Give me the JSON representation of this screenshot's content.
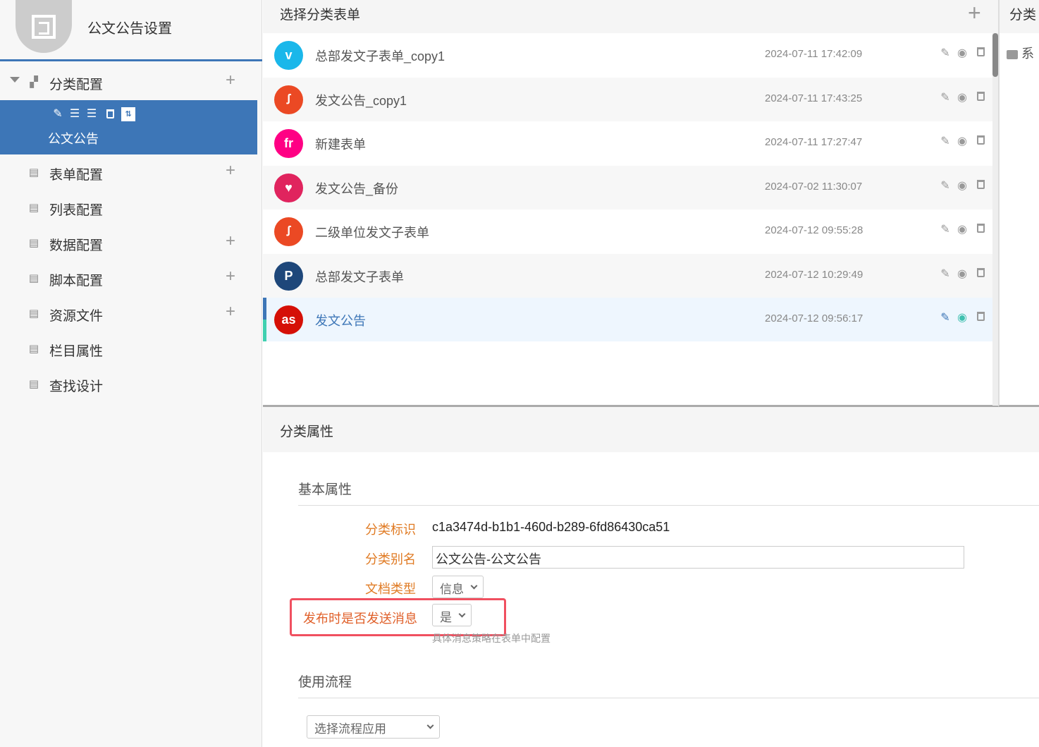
{
  "app": {
    "title": "公文公告设置"
  },
  "sidebar": {
    "group": "分类配置",
    "selected": "公文公告",
    "items": [
      {
        "label": "表单配置",
        "icon": "form-icon",
        "plus": true
      },
      {
        "label": "列表配置",
        "icon": "list-icon",
        "plus": false
      },
      {
        "label": "数据配置",
        "icon": "chart-icon",
        "plus": true
      },
      {
        "label": "脚本配置",
        "icon": "terminal-icon",
        "plus": true
      },
      {
        "label": "资源文件",
        "icon": "terminal-icon",
        "plus": true
      },
      {
        "label": "栏目属性",
        "icon": "sliders-icon",
        "plus": false
      },
      {
        "label": "查找设计",
        "icon": "binoculars-icon",
        "plus": false
      }
    ]
  },
  "list": {
    "title": "选择分类表单",
    "rows": [
      {
        "name": "总部发文子表单_copy1",
        "date": "2024-07-11 17:42:09",
        "icon": "vimeo-icon",
        "glyph": "v",
        "color": "#1ab7ea"
      },
      {
        "name": "发文公告_copy1",
        "date": "2024-07-11 17:43:25",
        "icon": "stumbleupon-icon",
        "glyph": "ꭍ",
        "color": "#eb4924"
      },
      {
        "name": "新建表单",
        "date": "2024-07-11 17:27:47",
        "icon": "fr-icon",
        "glyph": "fr",
        "color": "#ff0084"
      },
      {
        "name": "发文公告_备份",
        "date": "2024-07-02 11:30:07",
        "icon": "heart-icon",
        "glyph": "♥",
        "color": "#e0245e"
      },
      {
        "name": "二级单位发文子表单",
        "date": "2024-07-12 09:55:28",
        "icon": "stumbleupon-icon",
        "glyph": "ꭍ",
        "color": "#eb4924"
      },
      {
        "name": "总部发文子表单",
        "date": "2024-07-12 10:29:49",
        "icon": "paypal-icon",
        "glyph": "P",
        "color": "#1e477a"
      },
      {
        "name": "发文公告",
        "date": "2024-07-12 09:56:17",
        "icon": "lastfm-icon",
        "glyph": "as",
        "color": "#d51007"
      }
    ]
  },
  "right": {
    "title": "分类",
    "item": "系"
  },
  "props": {
    "title": "分类属性",
    "basic": "基本属性",
    "id_label": "分类标识",
    "id_value": "c1a3474d-b1b1-460d-b289-6fd86430ca51",
    "alias_label": "分类别名",
    "alias_value": "公文公告-公文公告",
    "doctype_label": "文档类型",
    "doctype_value": "信息",
    "notify_label": "发布时是否发送消息",
    "notify_value": "是",
    "notify_hint": "具体消息策略在表单中配置",
    "flow": "使用流程",
    "flow_placeholder": "选择流程应用"
  }
}
